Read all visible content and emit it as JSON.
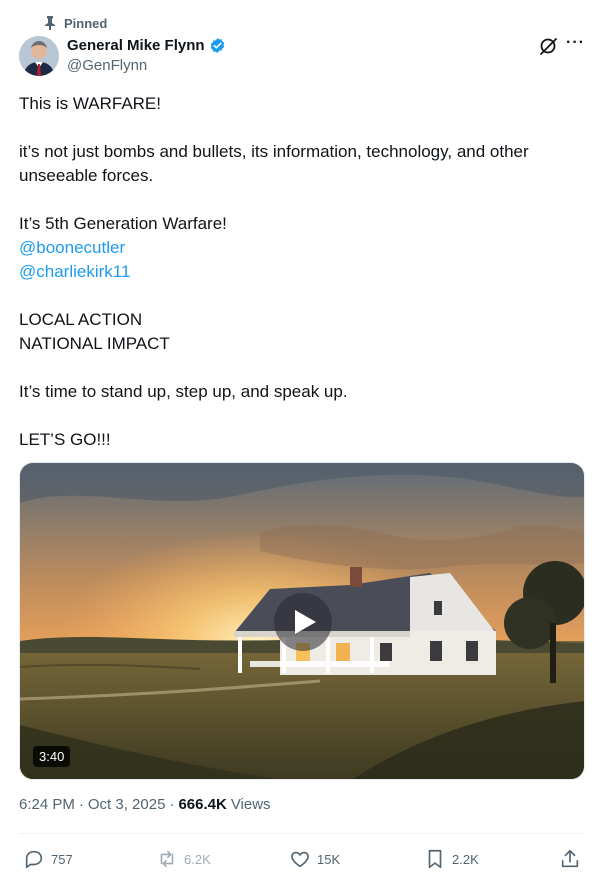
{
  "pinned_label": "Pinned",
  "author": {
    "name": "General Mike Flynn",
    "handle": "@GenFlynn"
  },
  "tweet": {
    "paragraphs": [
      "This is WARFARE!",
      "it’s not just bombs and bullets, its information, technology, and other unseeable forces.",
      "It’s 5th Generation Warfare!",
      "@boonecutler",
      "@charliekirk11",
      "LOCAL ACTION",
      "NATIONAL IMPACT",
      "It’s time to stand up, step up, and speak up.",
      "LET’S GO!!!"
    ]
  },
  "media": {
    "duration": "3:40"
  },
  "meta": {
    "time": "6:24 PM",
    "separator": "·",
    "date": "Oct 3, 2025",
    "views_count": "666.4K",
    "views_label": "Views"
  },
  "actions": {
    "replies": "757",
    "reposts": "6.2K",
    "likes": "15K",
    "bookmarks": "2.2K"
  },
  "colors": {
    "accent": "#1d9bf0",
    "text": "#0f1419",
    "secondary": "#536471"
  }
}
